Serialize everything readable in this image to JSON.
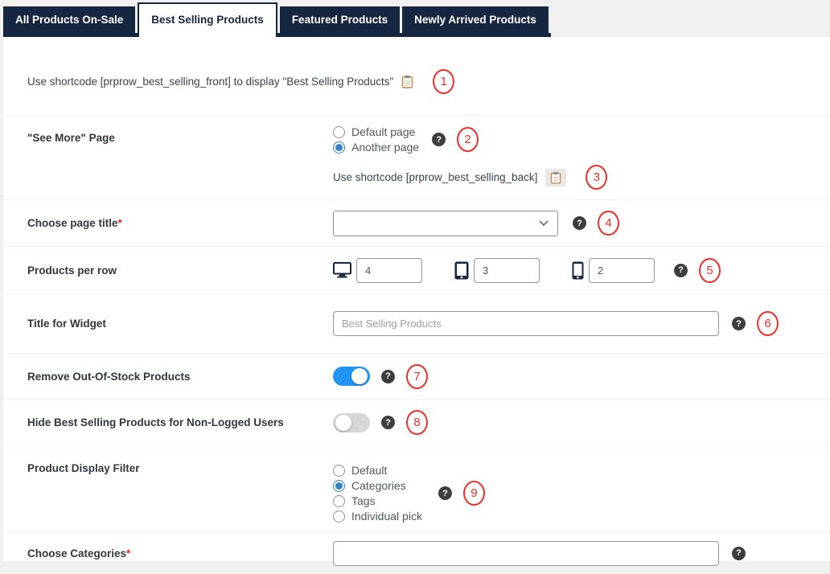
{
  "tabs": [
    {
      "label": "All Products On-Sale",
      "active": false
    },
    {
      "label": "Best Selling Products",
      "active": true
    },
    {
      "label": "Featured Products",
      "active": false
    },
    {
      "label": "Newly Arrived Products",
      "active": false
    }
  ],
  "icons": {
    "help_glyph": "?"
  },
  "colors": {
    "tab_navy": "#152740",
    "annotation_red": "#ee2e28",
    "toggle_on_blue": "#2196f3",
    "radio_blue": "#3582c4"
  },
  "shortcode_note": {
    "text": "Use shortcode [prprow_best_selling_front] to display \"Best Selling Products\"",
    "annotation": "1"
  },
  "rows": {
    "see_more": {
      "label": "\"See More\" Page",
      "options": [
        "Default page",
        "Another page"
      ],
      "selected": "Another page",
      "annotation": "2",
      "back_shortcode": {
        "text": "Use shortcode [prprow_best_selling_back]",
        "annotation": "3"
      }
    },
    "choose_page_title": {
      "label": "Choose page title",
      "required_mark": "*",
      "value": "",
      "annotation": "4"
    },
    "products_per_row": {
      "label": "Products per row",
      "desktop_value": "4",
      "tablet_value": "3",
      "mobile_value": "2",
      "annotation": "5"
    },
    "title_for_widget": {
      "label": "Title for Widget",
      "placeholder": "Best Selling Products",
      "annotation": "6"
    },
    "remove_out_of_stock": {
      "label": "Remove Out-Of-Stock Products",
      "state": "on",
      "annotation": "7"
    },
    "hide_non_logged": {
      "label": "Hide Best Selling Products for Non-Logged Users",
      "state": "off",
      "annotation": "8"
    },
    "product_display_filter": {
      "label": "Product Display Filter",
      "options": [
        "Default",
        "Categories",
        "Tags",
        "Individual pick"
      ],
      "selected": "Categories",
      "annotation": "9"
    },
    "choose_categories": {
      "label": "Choose Categories",
      "required_mark": "*",
      "value": ""
    }
  }
}
